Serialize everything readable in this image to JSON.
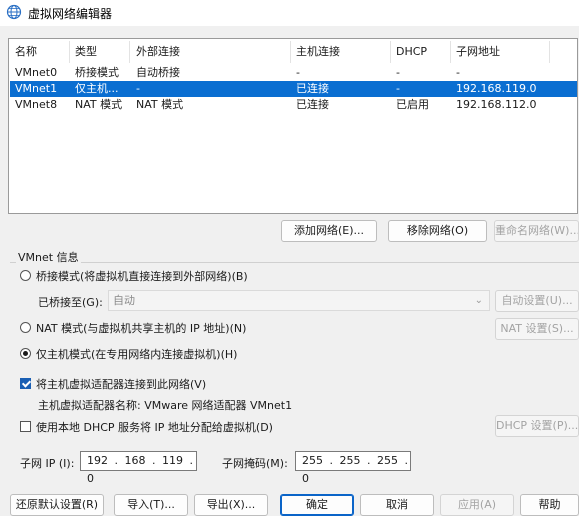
{
  "window": {
    "title": "虚拟网络编辑器",
    "icon": "network-globe-icon"
  },
  "table": {
    "headers": [
      "名称",
      "类型",
      "外部连接",
      "主机连接",
      "DHCP",
      "子网地址"
    ],
    "rows": [
      {
        "name": "VMnet0",
        "type": "桥接模式",
        "external": "自动桥接",
        "host": "-",
        "dhcp": "-",
        "subnet": "-",
        "selected": false
      },
      {
        "name": "VMnet1",
        "type": "仅主机...",
        "external": "-",
        "host": "已连接",
        "dhcp": "-",
        "subnet": "192.168.119.0",
        "selected": true
      },
      {
        "name": "VMnet8",
        "type": "NAT 模式",
        "external": "NAT 模式",
        "host": "已连接",
        "dhcp": "已启用",
        "subnet": "192.168.112.0",
        "selected": false
      }
    ]
  },
  "table_buttons": {
    "add": "添加网络(E)...",
    "remove": "移除网络(O)",
    "rename": "重命名网络(W)..."
  },
  "vmnet_info": {
    "label": "VMnet 信息",
    "bridged_radio": "桥接模式(将虚拟机直接连接到外部网络)(B)",
    "bridged_to_label": "已桥接至(G):",
    "bridged_to_value": "自动",
    "auto_settings": "自动设置(U)...",
    "nat_radio": "NAT 模式(与虚拟机共享主机的 IP 地址)(N)",
    "nat_settings": "NAT 设置(S)...",
    "hostonly_radio": "仅主机模式(在专用网络内连接虚拟机)(H)",
    "selected_mode": "hostonly",
    "connect_adapter": "将主机虚拟适配器连接到此网络(V)",
    "connect_adapter_checked": true,
    "adapter_name": "主机虚拟适配器名称: VMware 网络适配器 VMnet1",
    "use_dhcp": "使用本地 DHCP 服务将 IP 地址分配给虚拟机(D)",
    "use_dhcp_checked": false,
    "dhcp_settings": "DHCP 设置(P)...",
    "subnet_ip_label": "子网 IP (I):",
    "subnet_ip": "192 . 168 . 119 . 0",
    "subnet_mask_label": "子网掩码(M):",
    "subnet_mask": "255 . 255 . 255 . 0"
  },
  "footer": {
    "restore": "还原默认设置(R)",
    "import": "导入(T)...",
    "export": "导出(X)...",
    "ok": "确定",
    "cancel": "取消",
    "apply": "应用(A)",
    "help": "帮助"
  },
  "colors": {
    "selection": "#0a6ed1",
    "accent": "#0a64c8"
  }
}
